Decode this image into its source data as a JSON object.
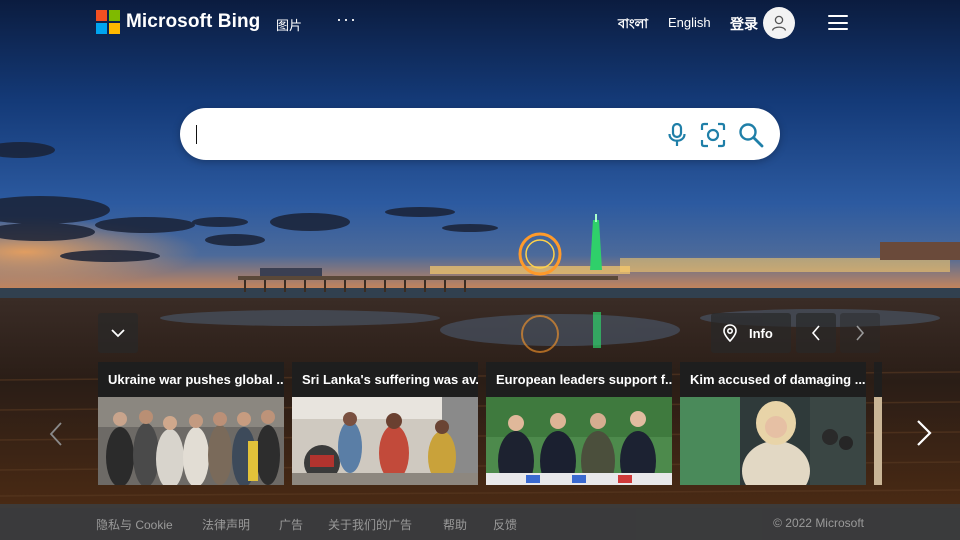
{
  "header": {
    "brand": "Microsoft Bing",
    "nav_images": "图片",
    "nav_more": "···",
    "lang_bengali": "বাংলা",
    "lang_english": "English",
    "sign_in": "登录"
  },
  "colors": {
    "ms_red": "#f25022",
    "ms_green": "#7fba00",
    "ms_blue": "#00a4ef",
    "ms_yellow": "#ffb900",
    "search_icon": "#1f7fa8"
  },
  "search": {
    "value": "",
    "placeholder": ""
  },
  "controls": {
    "info_label": "Info"
  },
  "news": [
    {
      "title": "Ukraine war pushes global ...",
      "image": "refugees-photo"
    },
    {
      "title": "Sri Lanka's suffering was av...",
      "image": "street-photo"
    },
    {
      "title": "European leaders support f...",
      "image": "leaders-photo"
    },
    {
      "title": "Kim accused of damaging ...",
      "image": "celebrity-photo"
    }
  ],
  "footer": {
    "privacy": "隐私与 Cookie",
    "legal": "法律声明",
    "ads": "广告",
    "about_ads": "关于我们的广告",
    "help": "帮助",
    "feedback": "反馈",
    "copyright": "© 2022 Microsoft"
  }
}
